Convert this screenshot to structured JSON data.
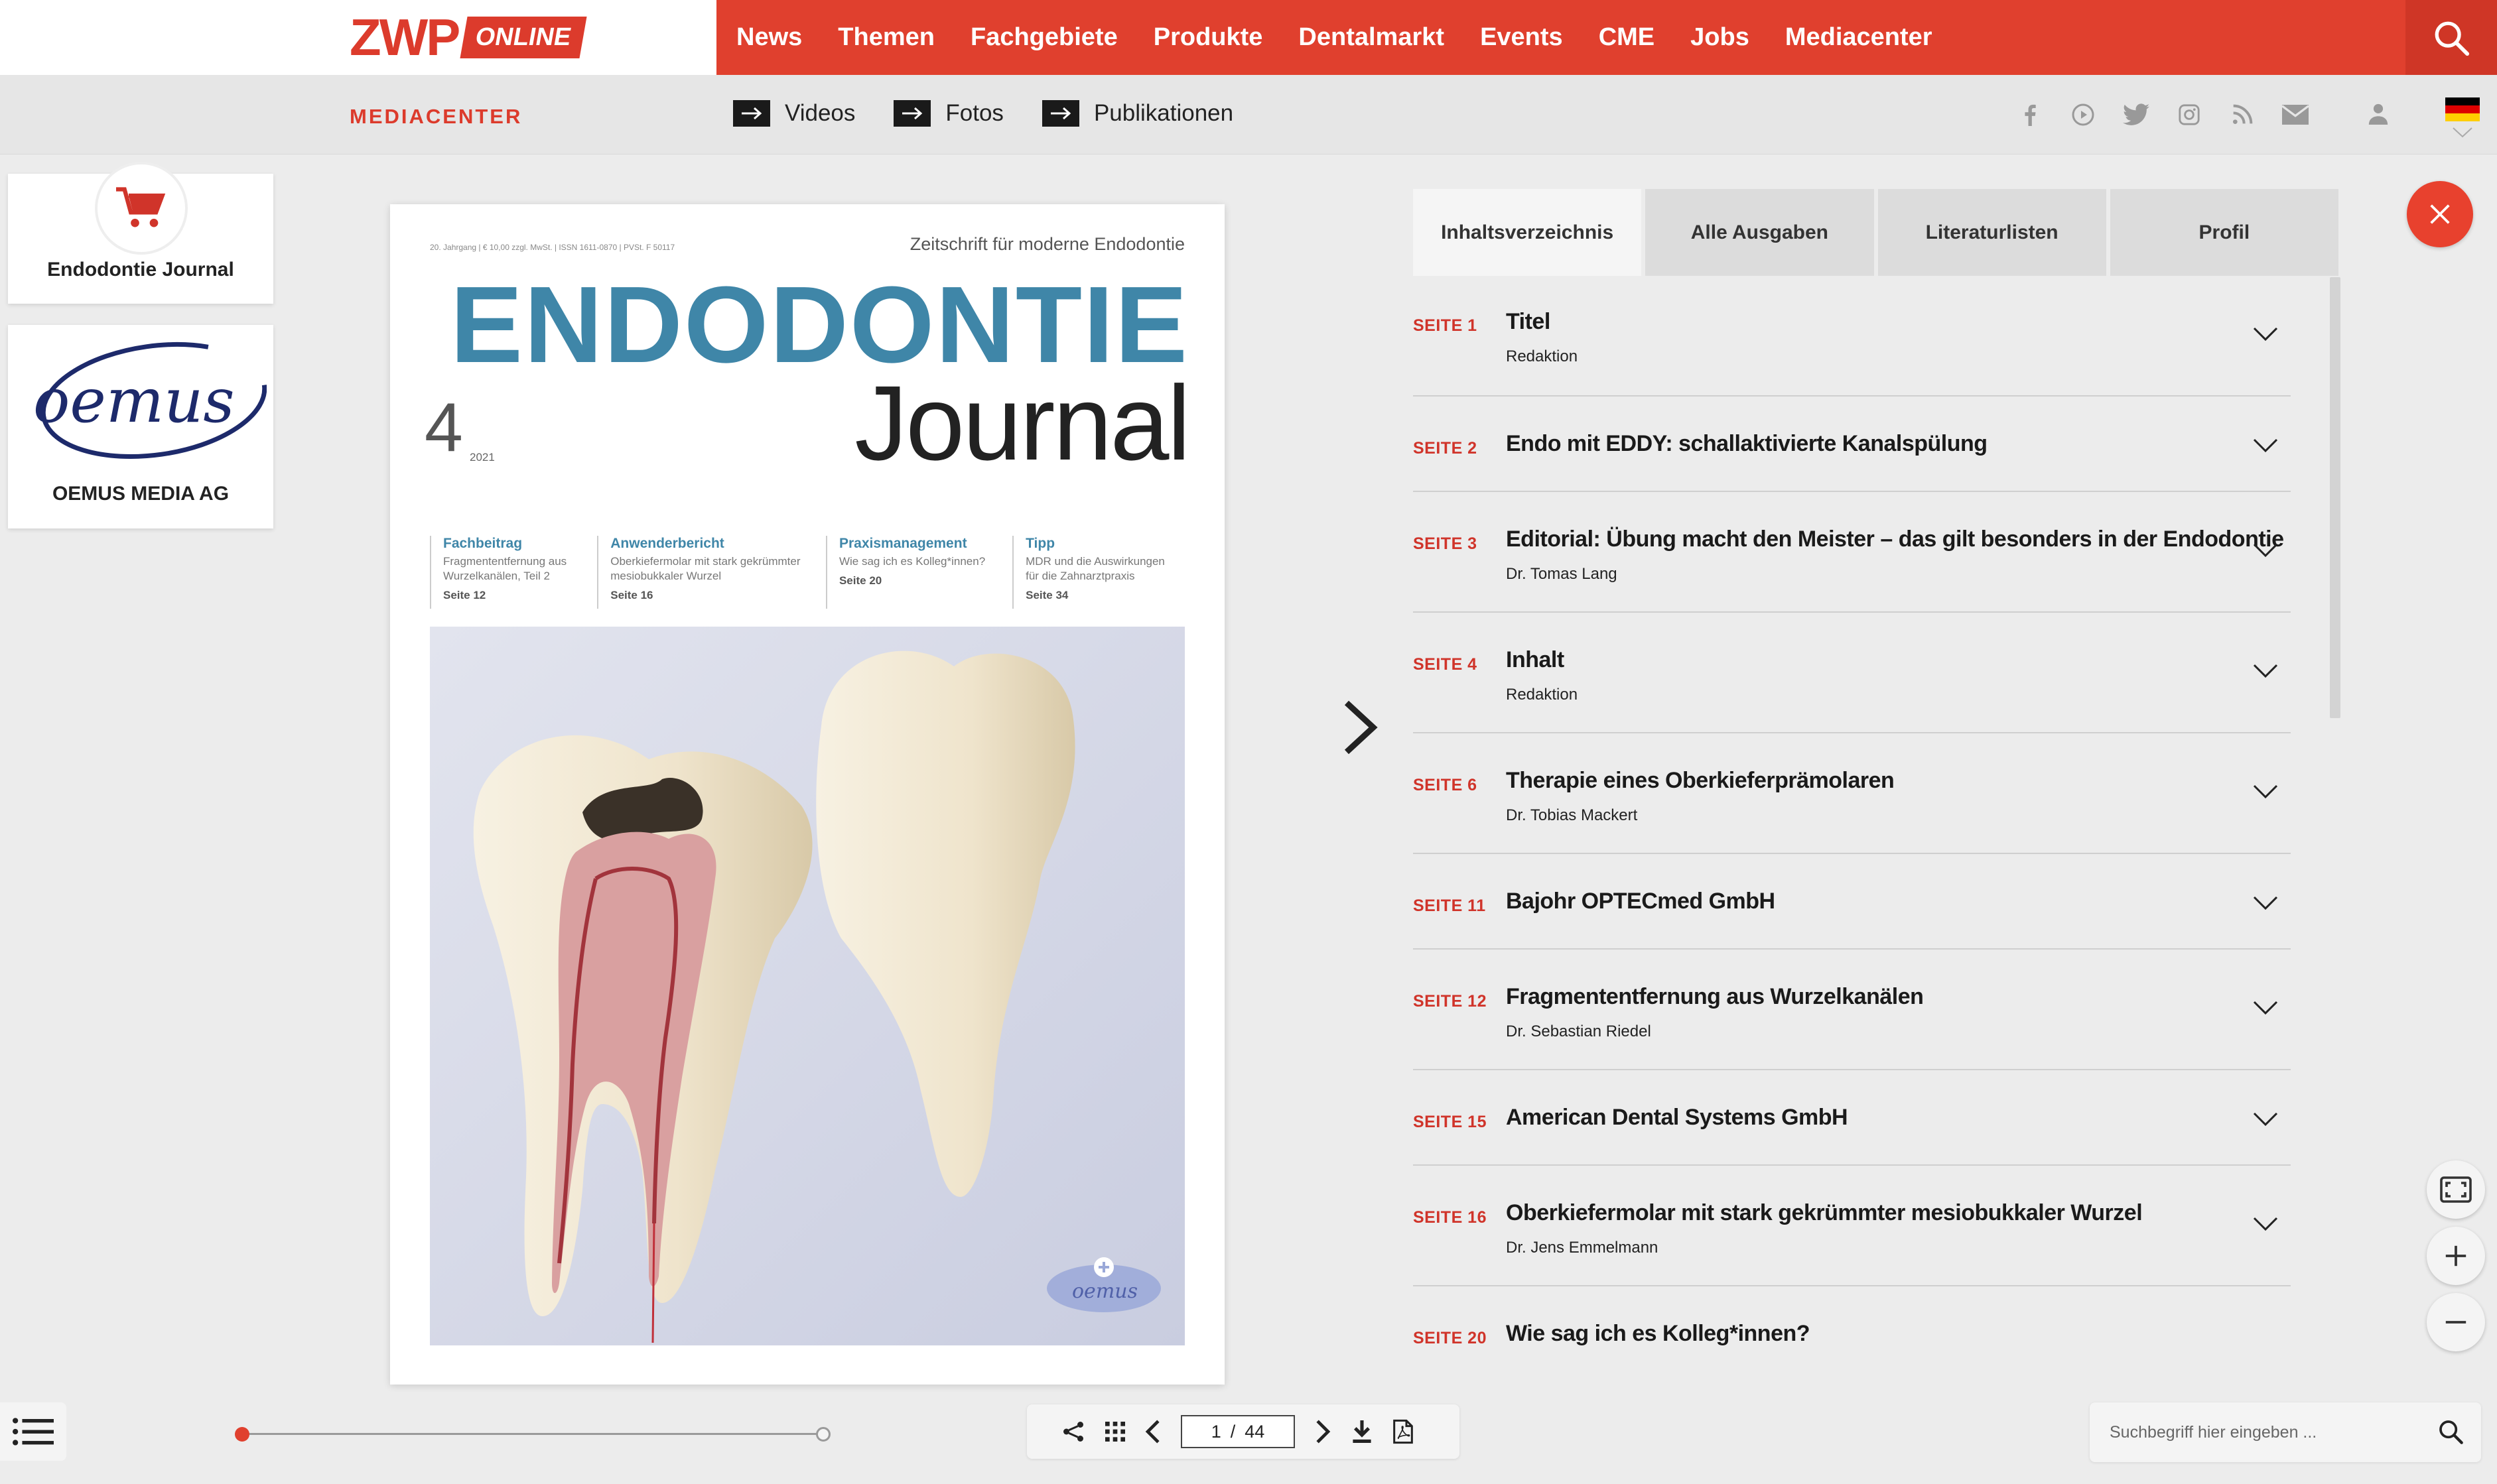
{
  "header": {
    "logo_main": "ZWP",
    "logo_badge": "ONLINE",
    "nav": [
      "News",
      "Themen",
      "Fachgebiete",
      "Produkte",
      "Dentalmarkt",
      "Events",
      "CME",
      "Jobs",
      "Mediacenter"
    ]
  },
  "subbar": {
    "label": "MEDIACENTER",
    "links": [
      "Videos",
      "Fotos",
      "Publikationen"
    ],
    "social_icons": [
      "facebook-icon",
      "youtube-icon",
      "twitter-icon",
      "instagram-icon",
      "rss-icon",
      "mail-icon"
    ]
  },
  "cards": {
    "shop_label": "Endodontie Journal",
    "publisher_logo": "oemus",
    "publisher_label": "OEMUS MEDIA AG"
  },
  "magazine": {
    "meta": "20. Jahrgang | € 10,00 zzgl. MwSt. | ISSN 1611-0870 | PVSt. F 50117",
    "subtitle": "Zeitschrift für moderne Endodontie",
    "title_line1": "ENDODONTIE",
    "title_line2": "Journal",
    "issue": "4",
    "year": "2021",
    "teasers": [
      {
        "head": "Fachbeitrag",
        "text": "Fragmententfernung aus Wurzelkanälen, Teil 2",
        "page": "Seite 12"
      },
      {
        "head": "Anwenderbericht",
        "text": "Oberkiefermolar mit stark gekrümmter mesiobukkaler Wurzel",
        "page": "Seite 16"
      },
      {
        "head": "Praxismanagement",
        "text": "Wie sag ich es Kolleg*innen?",
        "page": "Seite 20"
      },
      {
        "head": "Tipp",
        "text": "MDR und die Auswirkungen für die Zahnarztpraxis",
        "page": "Seite 34"
      }
    ],
    "badge_text": "oemus"
  },
  "panel": {
    "tabs": [
      "Inhaltsverzeichnis",
      "Alle Ausgaben",
      "Literaturlisten",
      "Profil"
    ],
    "toc": [
      {
        "page": "SEITE 1",
        "title": "Titel",
        "sub": "Redaktion"
      },
      {
        "page": "SEITE 2",
        "title": "Endo mit EDDY: schallaktivierte Kanalspülung",
        "sub": ""
      },
      {
        "page": "SEITE 3",
        "title": "Editorial: Übung macht den Meister – das gilt besonders in der Endodontie",
        "sub": "Dr. Tomas Lang"
      },
      {
        "page": "SEITE 4",
        "title": "Inhalt",
        "sub": "Redaktion"
      },
      {
        "page": "SEITE 6",
        "title": "Therapie eines Oberkieferprämolaren",
        "sub": "Dr. Tobias Mackert"
      },
      {
        "page": "SEITE 11",
        "title": "Bajohr OPTECmed GmbH",
        "sub": ""
      },
      {
        "page": "SEITE 12",
        "title": "Fragmententfernung aus Wurzelkanälen",
        "sub": "Dr. Sebastian Riedel"
      },
      {
        "page": "SEITE 15",
        "title": "American Dental Systems GmbH",
        "sub": ""
      },
      {
        "page": "SEITE 16",
        "title": "Oberkiefermolar mit stark gekrümmter mesiobukkaler Wurzel",
        "sub": "Dr. Jens Emmelmann"
      },
      {
        "page": "SEITE 20",
        "title": "Wie sag ich es Kolleg*innen?",
        "sub": ""
      }
    ]
  },
  "viewer": {
    "current_page": "1",
    "separator": "/",
    "total_pages": "44",
    "search_placeholder": "Suchbegriff hier eingeben ..."
  },
  "colors": {
    "brand_red": "#e0402e",
    "title_blue": "#3f86a8"
  }
}
